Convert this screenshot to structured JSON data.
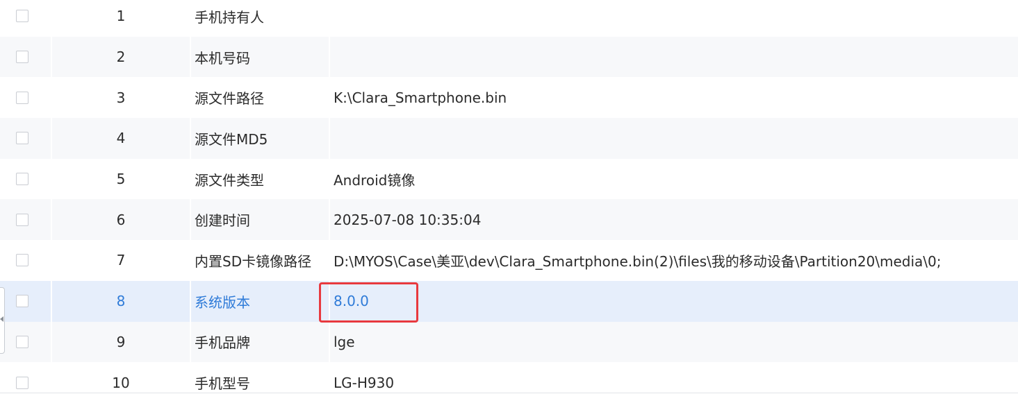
{
  "rows": [
    {
      "index": "1",
      "name": "手机持有人",
      "value": ""
    },
    {
      "index": "2",
      "name": "本机号码",
      "value": ""
    },
    {
      "index": "3",
      "name": "源文件路径",
      "value": "K:\\Clara_Smartphone.bin"
    },
    {
      "index": "4",
      "name": "源文件MD5",
      "value": ""
    },
    {
      "index": "5",
      "name": "源文件类型",
      "value": "Android镜像"
    },
    {
      "index": "6",
      "name": "创建时间",
      "value": "2025-07-08 10:35:04"
    },
    {
      "index": "7",
      "name": "内置SD卡镜像路径",
      "value": "D:\\MYOS\\Case\\美亚\\dev\\Clara_Smartphone.bin(2)\\files\\我的移动设备\\Partition20\\media\\0;"
    },
    {
      "index": "8",
      "name": "系统版本",
      "value": "8.0.0"
    },
    {
      "index": "9",
      "name": "手机品牌",
      "value": "lge"
    },
    {
      "index": "10",
      "name": "手机型号",
      "value": "LG-H930"
    }
  ],
  "selected_row_index": "8",
  "colors": {
    "selected_text": "#2f7bd8",
    "selected_bg": "#e6eefb",
    "alt_row_bg": "#f7f8fa",
    "highlight_border": "#e8393e"
  }
}
